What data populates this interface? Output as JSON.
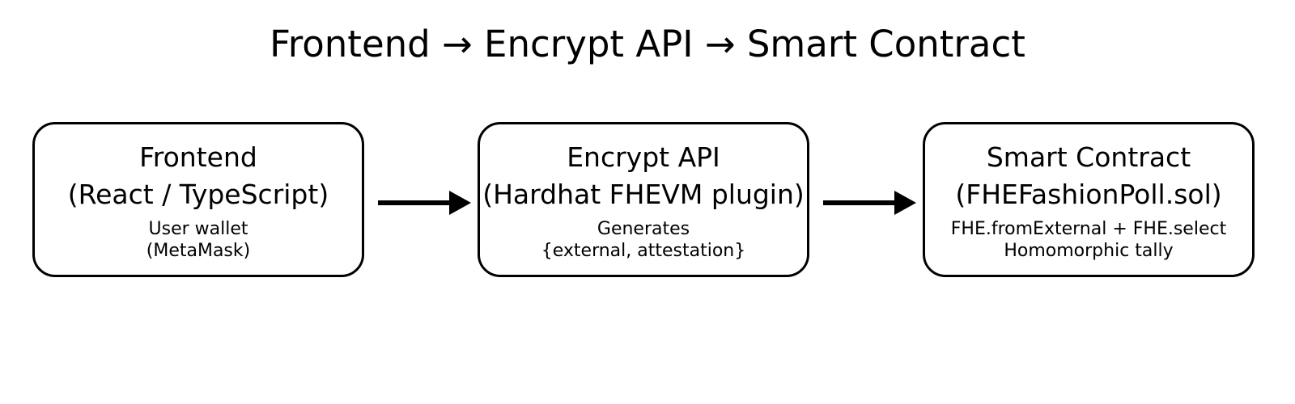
{
  "diagram": {
    "title": "Frontend → Encrypt API → Smart Contract",
    "nodes": [
      {
        "title": "Frontend",
        "subtitle": "(React / TypeScript)",
        "note_line1": "User wallet",
        "note_line2": "(MetaMask)"
      },
      {
        "title": "Encrypt API",
        "subtitle": "(Hardhat FHEVM plugin)",
        "note_line1": "Generates",
        "note_line2": "{external, attestation}"
      },
      {
        "title": "Smart Contract",
        "subtitle": "(FHEFashionPoll.sol)",
        "note_line1": "FHE.fromExternal + FHE.select",
        "note_line2": "Homomorphic tally"
      }
    ],
    "edges": [
      {
        "from": 0,
        "to": 1
      },
      {
        "from": 1,
        "to": 2
      }
    ],
    "colors": {
      "stroke": "#000000",
      "text": "#000000",
      "background": "#ffffff"
    }
  }
}
